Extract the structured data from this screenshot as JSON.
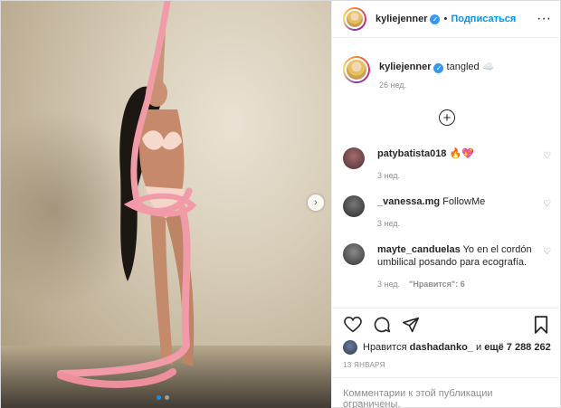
{
  "post": {
    "username": "kyliejenner",
    "follow_label": "Подписаться",
    "separator": "•",
    "more_label": "···",
    "next_label": "›",
    "caption": {
      "text": "tangled ☁️",
      "time": "26 нед."
    },
    "load_more_label": "+",
    "comments": [
      {
        "username": "patybatista018",
        "text": "🔥💖",
        "time": "3 нед.",
        "likes": ""
      },
      {
        "username": "_vanessa.mg",
        "text": "FollowMe",
        "time": "3 нед.",
        "likes": ""
      },
      {
        "username": "mayte_canduelas",
        "text": "Yo en el cordón umbilical posando para ecografía.",
        "time": "3 нед.",
        "likes": "\"Нравится\": 6"
      }
    ],
    "liked_by": {
      "prefix": "Нравится",
      "user": "dashadanko_",
      "middle": "и",
      "rest": "ещё 7 288 262"
    },
    "date": "13 ЯНВАРЯ",
    "comments_disabled": "Комментарии к этой публикации ограничены.",
    "colors": {
      "accent": "#0095f6",
      "verified": "#3897f0",
      "rope": "#f19aa8"
    }
  }
}
